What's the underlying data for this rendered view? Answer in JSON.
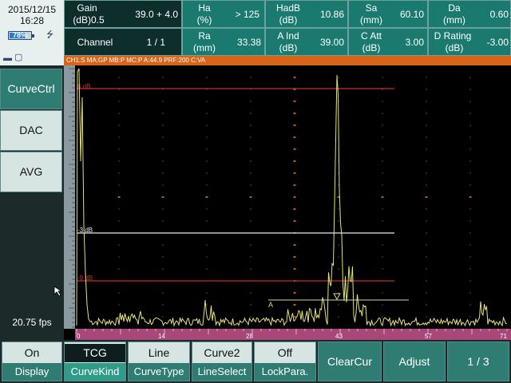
{
  "status": {
    "date": "2015/12/15",
    "time": "16:28",
    "battery_percent": 78,
    "battery_label": "78%",
    "fps": "20.75 fps"
  },
  "measures": {
    "gain_label_1": "Gain",
    "gain_label_2": "(dB)0.5",
    "gain_value": "39.0 + 4.0",
    "channel_label": "Channel",
    "channel_value": "1 / 1",
    "ha_label_1": "Ha",
    "ha_label_2": "(%)",
    "ha_value": "> 125",
    "ra_label_1": "Ra",
    "ra_label_2": "(mm)",
    "ra_value": "33.38",
    "hadb_label_1": "HadB",
    "hadb_label_2": "(dB)",
    "hadb_value": "10.86",
    "aind_label_1": "A Ind",
    "aind_label_2": "(dB)",
    "aind_value": "39.00",
    "sa_label_1": "Sa",
    "sa_label_2": "(mm)",
    "sa_value": "60.10",
    "catt_label_1": "C Att",
    "catt_label_2": "(dB)",
    "catt_value": "3.00",
    "da_label_1": "Da",
    "da_label_2": "(mm)",
    "da_value": "0.60",
    "drating_label_1": "D Rating",
    "drating_label_2": "(dB)",
    "drating_value": "-3.00"
  },
  "status_bar": "CH1:S  MA:GP  MB:P  MC:P  A:44.9  PRF:200  C:VA",
  "left_menu": [
    "CurveCtrl",
    "DAC",
    "AVG"
  ],
  "scope": {
    "curve_labels": [
      "6 dB",
      "-3 dB",
      "-9 dB"
    ],
    "gate_label": "A",
    "x_ticks": [
      "0",
      "14",
      "28",
      "43",
      "57",
      "71"
    ],
    "colors": {
      "background": "#000000",
      "signal": "#e4e27a",
      "curve_red": "#c03030",
      "curve_white": "#e8e8e8",
      "grid_dot": "#d8641a",
      "axis_ruler": "#a84878"
    }
  },
  "bottom_menu": [
    {
      "top": "On",
      "bottom": "Display"
    },
    {
      "top": "TCG",
      "bottom": "CurveKind"
    },
    {
      "top": "Line",
      "bottom": "CurveType"
    },
    {
      "top": "Curve2",
      "bottom": "LineSelect"
    },
    {
      "top": "Off",
      "bottom": "LockPara."
    },
    {
      "single": "ClearCur"
    },
    {
      "single": "Adjust"
    },
    {
      "single": "1 / 3"
    }
  ]
}
